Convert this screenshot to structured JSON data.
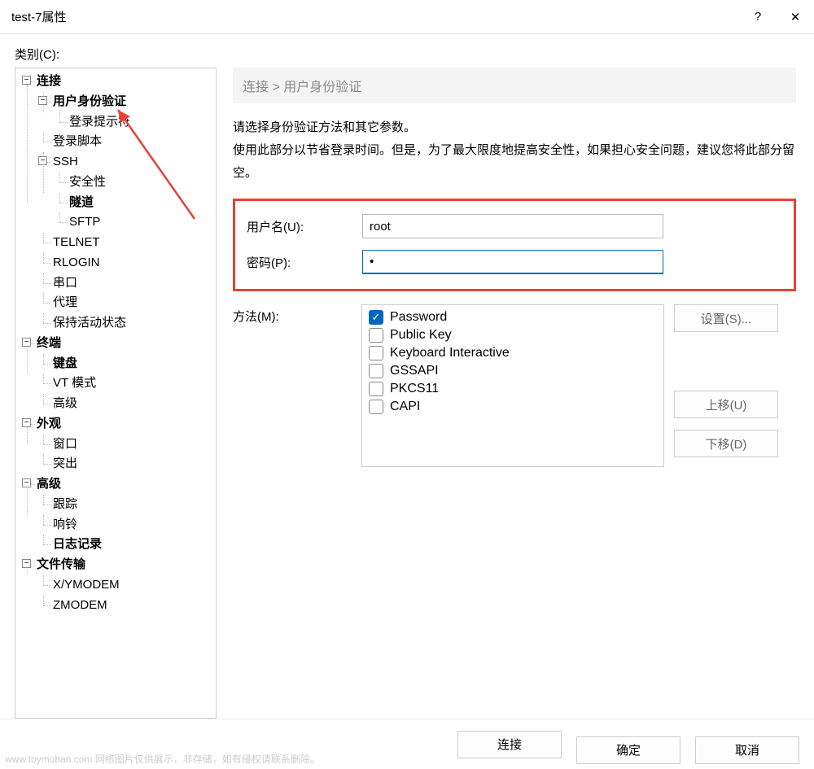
{
  "window": {
    "title": "test-7属性",
    "help": "?",
    "close": "✕"
  },
  "category_label": "类别(C):",
  "tree": {
    "connection": "连接",
    "user_auth": "用户身份验证",
    "login_prompt": "登录提示符",
    "login_script": "登录脚本",
    "ssh": "SSH",
    "security": "安全性",
    "tunnel": "隧道",
    "sftp": "SFTP",
    "telnet": "TELNET",
    "rlogin": "RLOGIN",
    "serial": "串口",
    "proxy": "代理",
    "keepalive": "保持活动状态",
    "terminal": "终端",
    "keyboard": "键盘",
    "vtmode": "VT 模式",
    "advanced_term": "高级",
    "appearance": "外观",
    "window": "窗口",
    "highlight": "突出",
    "advanced": "高级",
    "trace": "跟踪",
    "bell": "响铃",
    "logging": "日志记录",
    "file_transfer": "文件传输",
    "xymodem": "X/YMODEM",
    "zmodem": "ZMODEM"
  },
  "breadcrumb": "连接 > 用户身份验证",
  "intro_line1": "请选择身份验证方法和其它参数。",
  "intro_line2": "使用此部分以节省登录时间。但是，为了最大限度地提高安全性，如果担心安全问题，建议您将此部分留空。",
  "form": {
    "username_label": "用户名(U):",
    "username_value": "root",
    "password_label": "密码(P):",
    "password_value": "•"
  },
  "method": {
    "label": "方法(M):",
    "items": [
      {
        "label": "Password",
        "checked": true
      },
      {
        "label": "Public Key",
        "checked": false
      },
      {
        "label": "Keyboard Interactive",
        "checked": false
      },
      {
        "label": "GSSAPI",
        "checked": false
      },
      {
        "label": "PKCS11",
        "checked": false
      },
      {
        "label": "CAPI",
        "checked": false
      }
    ]
  },
  "buttons": {
    "settings": "设置(S)...",
    "move_up": "上移(U)",
    "move_down": "下移(D)",
    "connect": "连接",
    "ok": "确定",
    "cancel": "取消"
  },
  "watermark": "www.toymoban.com 网络图片仅供展示，非存储，如有侵权请联系删除。"
}
